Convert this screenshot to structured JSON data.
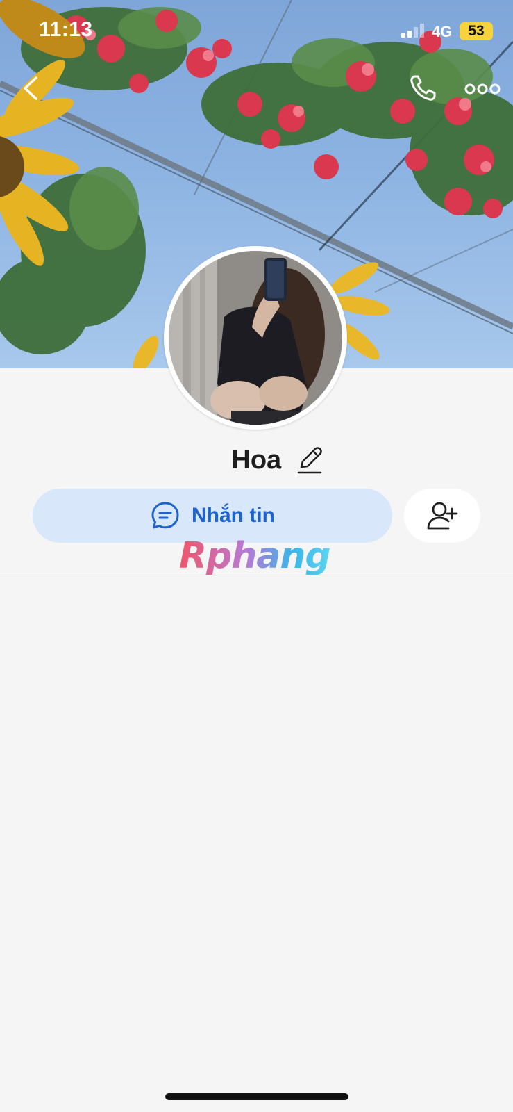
{
  "status_bar": {
    "time": "11:13",
    "network": "4G",
    "battery": "53",
    "signal_icon": "cellular-signal-icon"
  },
  "nav": {
    "back_icon": "chevron-left-icon",
    "call_icon": "phone-icon",
    "more_icon": "more-horizontal-icon"
  },
  "cover": {
    "description_icon": "cover-photo"
  },
  "profile": {
    "name": "Hoa",
    "edit_icon": "pencil-icon"
  },
  "actions": {
    "message_label": "Nhắn tin",
    "message_icon": "chat-bubble-icon",
    "add_friend_icon": "add-user-icon"
  },
  "watermark": {
    "text": "Rphang"
  },
  "colors": {
    "background": "#f5f5f5",
    "message_button_bg": "#d9e7fb",
    "accent": "#1f63cf",
    "battery_bg": "#f6d23c"
  }
}
